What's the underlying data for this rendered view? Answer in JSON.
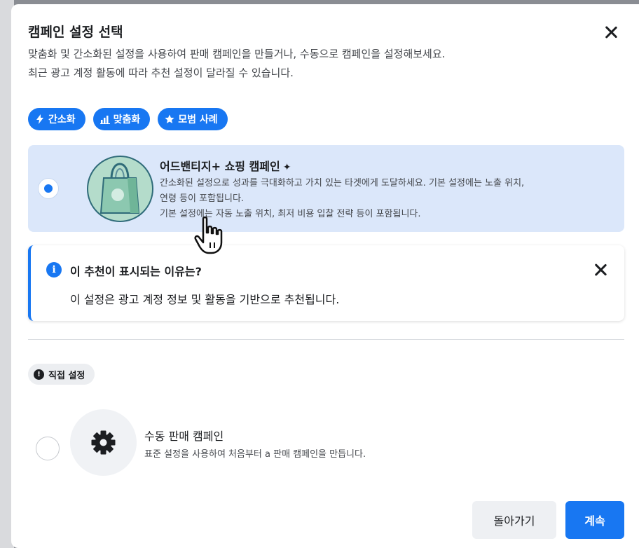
{
  "modal": {
    "title": "캠페인 설정 선택",
    "subtitle_line1": "맞춤화 및 간소화된 설정을 사용하여 판매 캠페인을 만들거나, 수동으로 캠페인을 설정해보세요.",
    "subtitle_line2": "최근 광고 계정 활동에 따라 추천 설정이 달라질 수 있습니다."
  },
  "tags": [
    {
      "label": "간소화",
      "icon": "lightning-icon"
    },
    {
      "label": "맞춤화",
      "icon": "bar-chart-icon"
    },
    {
      "label": "모범 사례",
      "icon": "star-icon"
    }
  ],
  "advantage_option": {
    "title": "어드밴티지+ 쇼핑 캠페인",
    "sparkle": "✦",
    "desc_line1": "간소화된 설정으로 성과를 극대화하고 가치 있는 타겟에게 도달하세요. 기본 설정에는 노출 위치,",
    "desc_line2": "연령 등이 포함됩니다.",
    "desc_line3": "기본 설정에는 자동 노출 위치, 최저 비용 입찰 전략 등이 포함됩니다.",
    "selected": true
  },
  "info_box": {
    "icon_glyph": "i",
    "title": "이 추천이 표시되는 이유는?",
    "text": "이 설정은 광고 계정 정보 및 활동을 기반으로 추천됩니다."
  },
  "manual_section": {
    "chip_icon_glyph": "!",
    "chip_label": "직접 설정",
    "title": "수동 판매 캠페인",
    "desc": "표준 설정을 사용하여 처음부터 a 판매 캠페인을 만듭니다.",
    "selected": false
  },
  "footer": {
    "back_label": "돌아가기",
    "continue_label": "계속"
  },
  "colors": {
    "accent": "#1877f2",
    "selected_card_bg": "#dbe7fa",
    "bag_bg": "#b4dccb"
  }
}
